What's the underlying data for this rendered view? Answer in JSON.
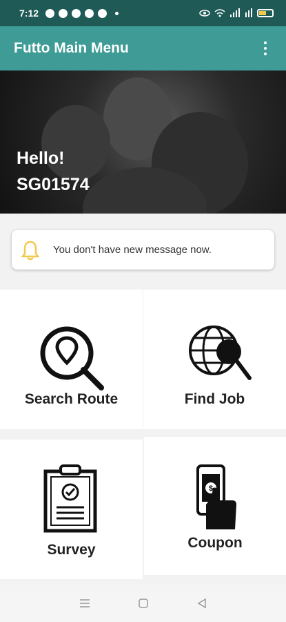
{
  "status_bar": {
    "time": "7:12"
  },
  "app_bar": {
    "title": "Futto Main Menu"
  },
  "hero": {
    "greeting": "Hello!",
    "user_id": "SG01574"
  },
  "notice": {
    "message": "You don't have new message now."
  },
  "menu": {
    "search_route": "Search Route",
    "find_job": "Find Job",
    "survey": "Survey",
    "coupon": "Coupon"
  },
  "colors": {
    "accent": "#3e9b95",
    "status_bar": "#1f5a56",
    "bell": "#f2c94c"
  },
  "icons": [
    "map-pin-search-icon",
    "globe-search-icon",
    "clipboard-check-icon",
    "phone-coupon-icon",
    "bell-icon"
  ]
}
